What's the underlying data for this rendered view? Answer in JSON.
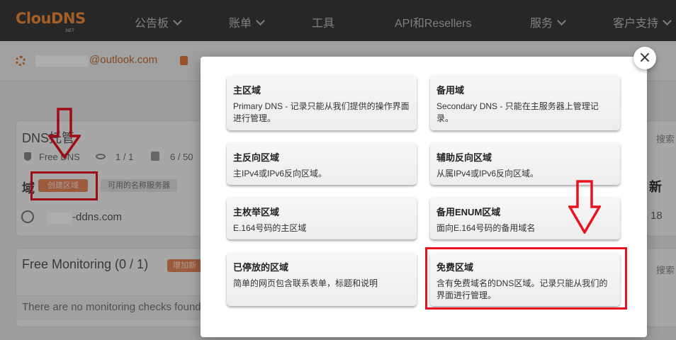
{
  "brand": {
    "logo_text": "ClouDNS",
    "logo_sub": ".NET"
  },
  "nav": {
    "items": [
      {
        "label": "公告板",
        "has_dropdown": true
      },
      {
        "label": "账单",
        "has_dropdown": true
      },
      {
        "label": "工具",
        "has_dropdown": false
      },
      {
        "label": "API和Resellers",
        "has_dropdown": false
      },
      {
        "label": "服务",
        "has_dropdown": true
      },
      {
        "label": "客户支持",
        "has_dropdown": true
      }
    ]
  },
  "account": {
    "email_suffix": "@outlook.com"
  },
  "background": {
    "dns_title": "DNS托管",
    "plan": "Free DNS",
    "stat1": "1 / 1",
    "stat2": "6 / 50",
    "zones_heading_partial": "域",
    "create_zone_button": "创建区域",
    "ns_button": "可用的名称服务器",
    "domain_suffix": "-ddns.com",
    "monitoring_title": "Free Monitoring (0 / 1)",
    "add_monitor_button": "增加新",
    "no_checks": "There are no monitoring checks found",
    "search_label": "搜索",
    "latest_label": "新",
    "number": "18"
  },
  "modal": {
    "close_label": "×",
    "options": [
      {
        "title": "主区域",
        "desc": "Primary DNS - 记录只能从我们提供的操作界面进行管理。"
      },
      {
        "title": "备用域",
        "desc": "Secondary DNS - 只能在主服务器上管理记录。"
      },
      {
        "title": "主反向区域",
        "desc": "主IPv4或IPv6反向区域。"
      },
      {
        "title": "辅助反向区域",
        "desc": "从属IPv4或IPv6反向区域。"
      },
      {
        "title": "主枚举区域",
        "desc": "E.164号码的主区域"
      },
      {
        "title": "备用ENUM区域",
        "desc": "面向E.164号码的备用域名"
      },
      {
        "title": "已停放的区域",
        "desc": "简单的网页包含联系表单，标题和说明"
      },
      {
        "title": "免费区域",
        "desc": "含有免费域名的DNS区域。记录只能从我们的界面进行管理。"
      }
    ]
  },
  "colors": {
    "highlight": "#e8131f",
    "accent": "#e8875a",
    "nav_bg": "#3a3a3a"
  }
}
